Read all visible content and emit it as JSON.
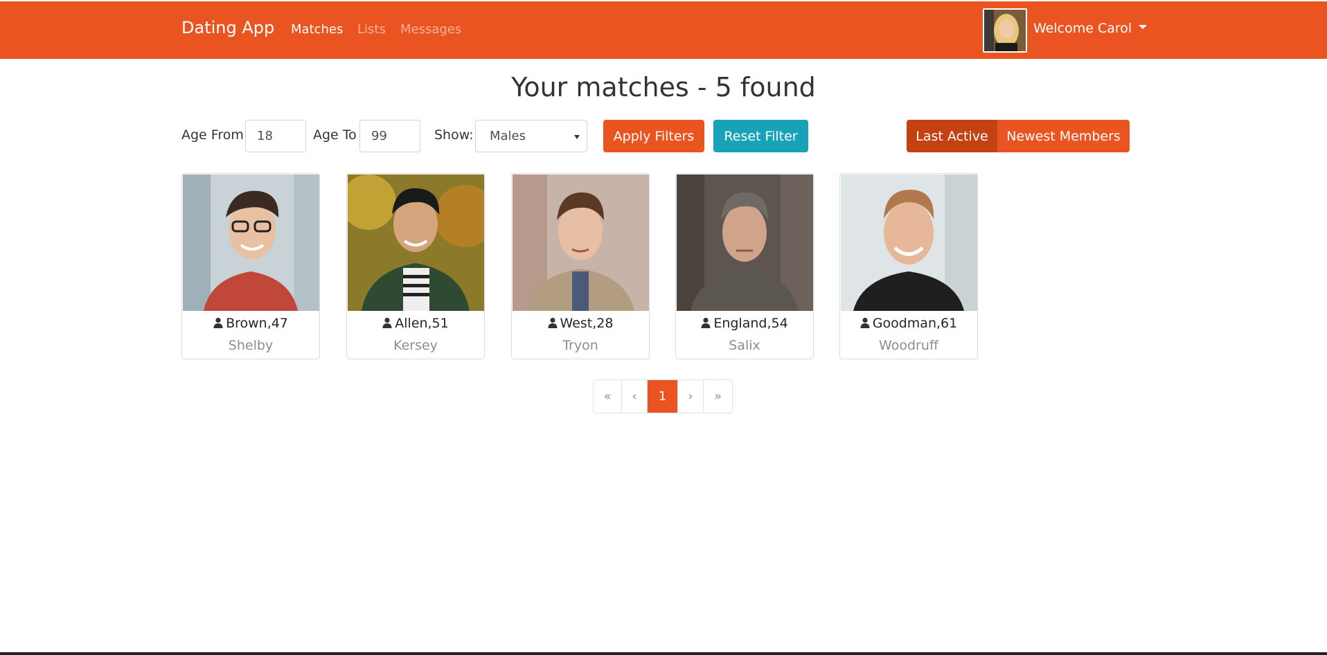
{
  "navbar": {
    "brand": "Dating App",
    "links": [
      {
        "label": "Matches",
        "active": true
      },
      {
        "label": "Lists",
        "active": false
      },
      {
        "label": "Messages",
        "active": false
      }
    ],
    "user_menu_label": "Welcome Carol",
    "accent_color": "#e95420"
  },
  "page": {
    "title": "Your matches - 5 found"
  },
  "filters": {
    "age_from_label": "Age From",
    "age_from_value": "18",
    "age_to_label": "Age To",
    "age_to_value": "99",
    "show_label": "Show:",
    "show_selected": "Males",
    "apply_label": "Apply Filters",
    "reset_label": "Reset Filter",
    "sort_options": [
      {
        "label": "Last Active",
        "active": true
      },
      {
        "label": "Newest Members",
        "active": false
      }
    ]
  },
  "members": [
    {
      "name_age": "Brown,47",
      "city": "Shelby"
    },
    {
      "name_age": "Allen,51",
      "city": "Kersey"
    },
    {
      "name_age": "West,28",
      "city": "Tryon"
    },
    {
      "name_age": "England,54",
      "city": "Salix"
    },
    {
      "name_age": "Goodman,61",
      "city": "Woodruff"
    }
  ],
  "pagination": {
    "first": "«",
    "prev": "‹",
    "current": "1",
    "next": "›",
    "last": "»"
  }
}
